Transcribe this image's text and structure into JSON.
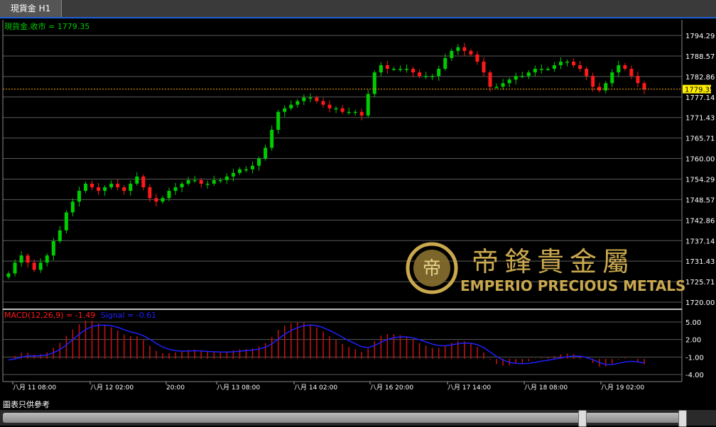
{
  "tab": {
    "title": "現貨金 H1"
  },
  "price_label": "現貨金.收市 = 1779.35",
  "current_price": "1779.35",
  "macd_label": {
    "main": "MACD(12,26,9) = -1.49",
    "signal": "Signal = -0.61"
  },
  "footer": {
    "note": "圖表只供參考"
  },
  "logo": {
    "chinese": "帝鋒貴金屬",
    "english": "EMPERIO PRECIOUS METALS"
  },
  "colors": {
    "up": "#00cc00",
    "down": "#ff1a1a",
    "grid": "#5a5a5a",
    "macd_bar": "#cc1010",
    "signal": "#2020ff",
    "label_green": "#00cc00",
    "current_line": "#ffaa00"
  },
  "chart_data": [
    {
      "type": "candlestick",
      "y_ticks": [
        "1794.29",
        "1788.57",
        "1782.86",
        "1777.14",
        "1771.43",
        "1765.71",
        "1760.00",
        "1754.29",
        "1748.57",
        "1742.86",
        "1737.14",
        "1731.43",
        "1725.71",
        "1720.00"
      ],
      "ylim": [
        1720.0,
        1794.29
      ],
      "x_ticks": [
        "八月 11 08:00",
        "八月 12 02:00",
        "20:00",
        "八月 13 08:00",
        "八月 14 02:00",
        "八月 16 20:00",
        "八月 17 14:00",
        "八月 18 08:00",
        "八月 19 02:00"
      ],
      "close_path": [
        1728,
        1731,
        1733,
        1731,
        1729,
        1731,
        1733,
        1737,
        1740,
        1745,
        1748,
        1751,
        1753,
        1752,
        1751,
        1752,
        1753,
        1752,
        1751,
        1753,
        1755,
        1752,
        1749,
        1748,
        1749,
        1751,
        1752,
        1753,
        1754,
        1754,
        1753,
        1753,
        1754,
        1754,
        1755,
        1756,
        1757,
        1757,
        1758,
        1760,
        1763,
        1768,
        1773,
        1774,
        1775,
        1776,
        1777,
        1777,
        1776,
        1775,
        1774,
        1774,
        1773,
        1773,
        1773,
        1772,
        1778,
        1784,
        1786,
        1785,
        1785,
        1785,
        1785,
        1784,
        1783,
        1783,
        1783,
        1785,
        1788,
        1790,
        1791,
        1790,
        1789,
        1787,
        1784,
        1780,
        1780,
        1781,
        1782,
        1783,
        1783,
        1784,
        1785,
        1785,
        1785,
        1786,
        1787,
        1787,
        1786,
        1785,
        1783,
        1780,
        1779,
        1781,
        1784,
        1786,
        1785,
        1783,
        1781,
        1779.35
      ],
      "last_close": 1779.35
    },
    {
      "type": "macd",
      "y_ticks": [
        "5.00",
        "2.00",
        "-1.00",
        "-4.00"
      ],
      "ylim": [
        -4.0,
        5.0
      ],
      "macd": -1.49,
      "signal": -0.61
    }
  ]
}
